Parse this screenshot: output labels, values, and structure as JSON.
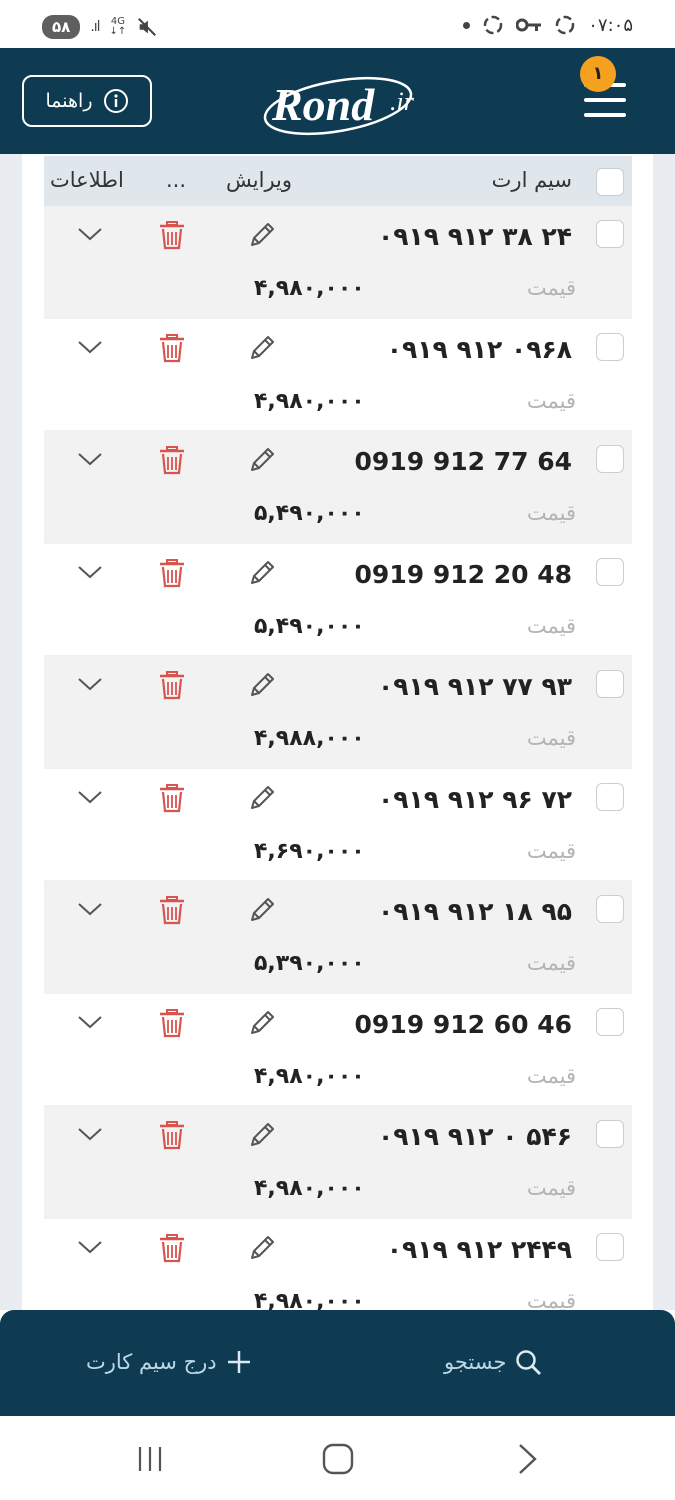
{
  "status_bar": {
    "battery": "۵۸",
    "network": "4G",
    "time": "۰۷:۰۵"
  },
  "header": {
    "help_label": "راهنما",
    "logo_text": "Rond",
    "logo_suffix": ".ir",
    "notification_count": "۱"
  },
  "table": {
    "columns": {
      "sim": "سیم ارت",
      "edit": "ویرایش",
      "more": "...",
      "info": "اطلاعات"
    },
    "price_label": "قیمت",
    "rows": [
      {
        "number": "۰۹۱۹ ۹۱۲ ۳۸ ۲۴",
        "price": "۴,۹۸۰,۰۰۰"
      },
      {
        "number": "۰۹۱۹ ۹۱۲ ۰۹۶۸",
        "price": "۴,۹۸۰,۰۰۰"
      },
      {
        "number": "0919 912 77 64",
        "price": "۵,۴۹۰,۰۰۰"
      },
      {
        "number": "0919 912 20 48",
        "price": "۵,۴۹۰,۰۰۰"
      },
      {
        "number": "۰۹۱۹ ۹۱۲ ۷۷ ۹۳",
        "price": "۴,۹۸۸,۰۰۰"
      },
      {
        "number": "۰۹۱۹ ۹۱۲ ۹۶ ۷۲",
        "price": "۴,۶۹۰,۰۰۰"
      },
      {
        "number": "۰۹۱۹ ۹۱۲ ۱۸ ۹۵",
        "price": "۵,۳۹۰,۰۰۰"
      },
      {
        "number": "0919 912 60 46",
        "price": "۴,۹۸۰,۰۰۰"
      },
      {
        "number": "۰۹۱۹ ۹۱۲ ۰ ۵۴۶",
        "price": "۴,۹۸۰,۰۰۰"
      },
      {
        "number": "۰۹۱۹ ۹۱۲ ۲۴۴۹",
        "price": "۴,۹۸۰,۰۰۰"
      }
    ]
  },
  "action_bar": {
    "add_label": "درج سیم کارت",
    "search_label": "جستجو"
  },
  "colors": {
    "header_bg": "#0e3b51",
    "badge": "#f5a01e",
    "trash": "#d9534f"
  }
}
